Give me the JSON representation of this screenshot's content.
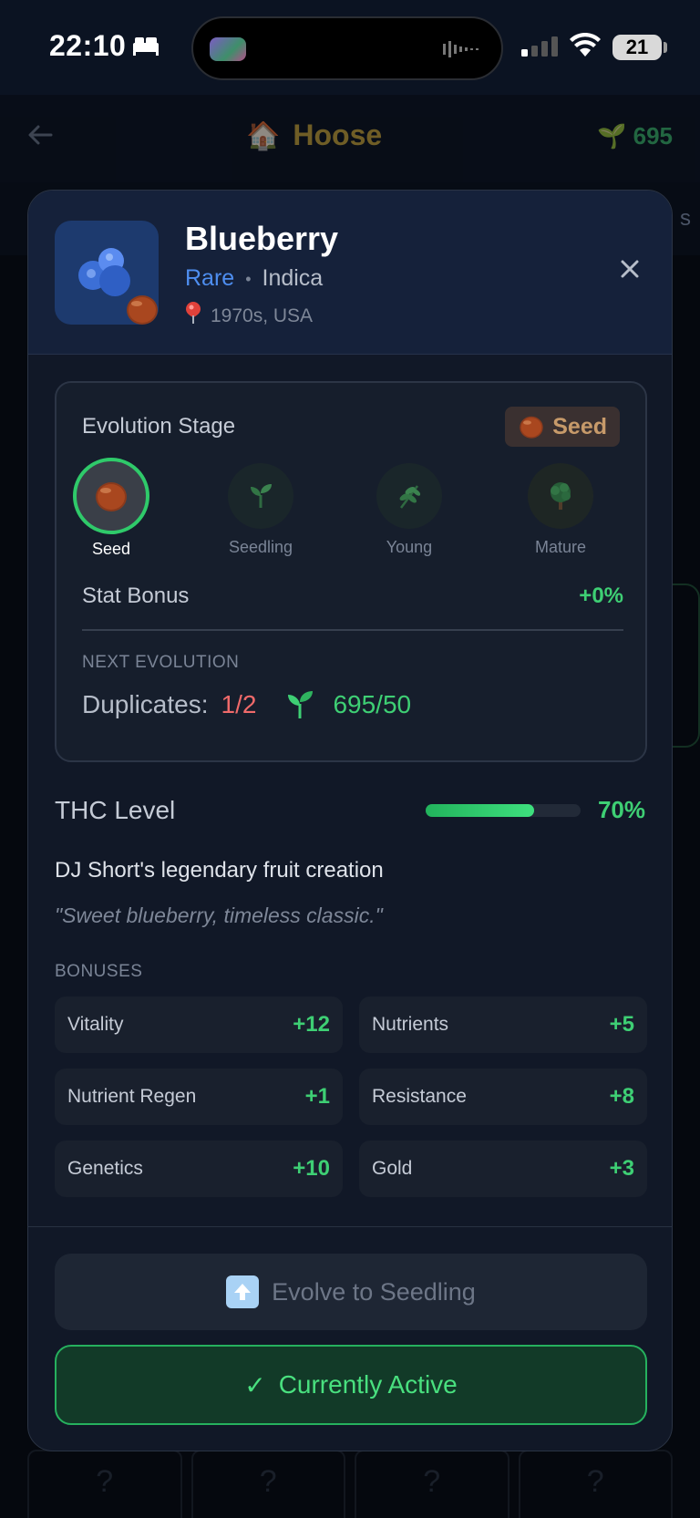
{
  "status_bar": {
    "time": "22:10",
    "battery": "21"
  },
  "app_header": {
    "title": "Hoose",
    "currency": "695",
    "subnav_fragment": "s"
  },
  "background_grid": [
    "?",
    "?",
    "?",
    "?"
  ],
  "strain": {
    "name": "Blueberry",
    "rarity": "Rare",
    "separator": "•",
    "type": "Indica",
    "origin": "1970s, USA"
  },
  "evolution": {
    "title": "Evolution Stage",
    "current_stage": "Seed",
    "stages": [
      {
        "label": "Seed",
        "icon": "seed-icon",
        "active": true
      },
      {
        "label": "Seedling",
        "icon": "seedling-icon",
        "active": false
      },
      {
        "label": "Young",
        "icon": "herb-icon",
        "active": false
      },
      {
        "label": "Mature",
        "icon": "tree-icon",
        "active": false
      }
    ],
    "stat_bonus_label": "Stat Bonus",
    "stat_bonus_value": "+0%",
    "next_label": "NEXT EVOLUTION",
    "duplicates_label": "Duplicates:",
    "duplicates_value": "1/2",
    "cost_value": "695/50"
  },
  "thc": {
    "label": "THC Level",
    "value": "70%",
    "fraction": 0.7
  },
  "description": "DJ Short's legendary fruit creation",
  "quote": "\"Sweet blueberry, timeless classic.\"",
  "bonuses": {
    "label": "BONUSES",
    "items": [
      {
        "name": "Vitality",
        "value": "+12"
      },
      {
        "name": "Nutrients",
        "value": "+5"
      },
      {
        "name": "Nutrient Regen",
        "value": "+1"
      },
      {
        "name": "Resistance",
        "value": "+8"
      },
      {
        "name": "Genetics",
        "value": "+10"
      },
      {
        "name": "Gold",
        "value": "+3"
      }
    ]
  },
  "actions": {
    "evolve_label": "Evolve to Seedling",
    "active_label": "Currently Active",
    "active_check": "✓"
  },
  "colors": {
    "accent_green": "#3ecf74",
    "rarity_blue": "#4e8ef0",
    "warning_red": "#f06a6a",
    "seed_brown": "#c79a6a"
  }
}
